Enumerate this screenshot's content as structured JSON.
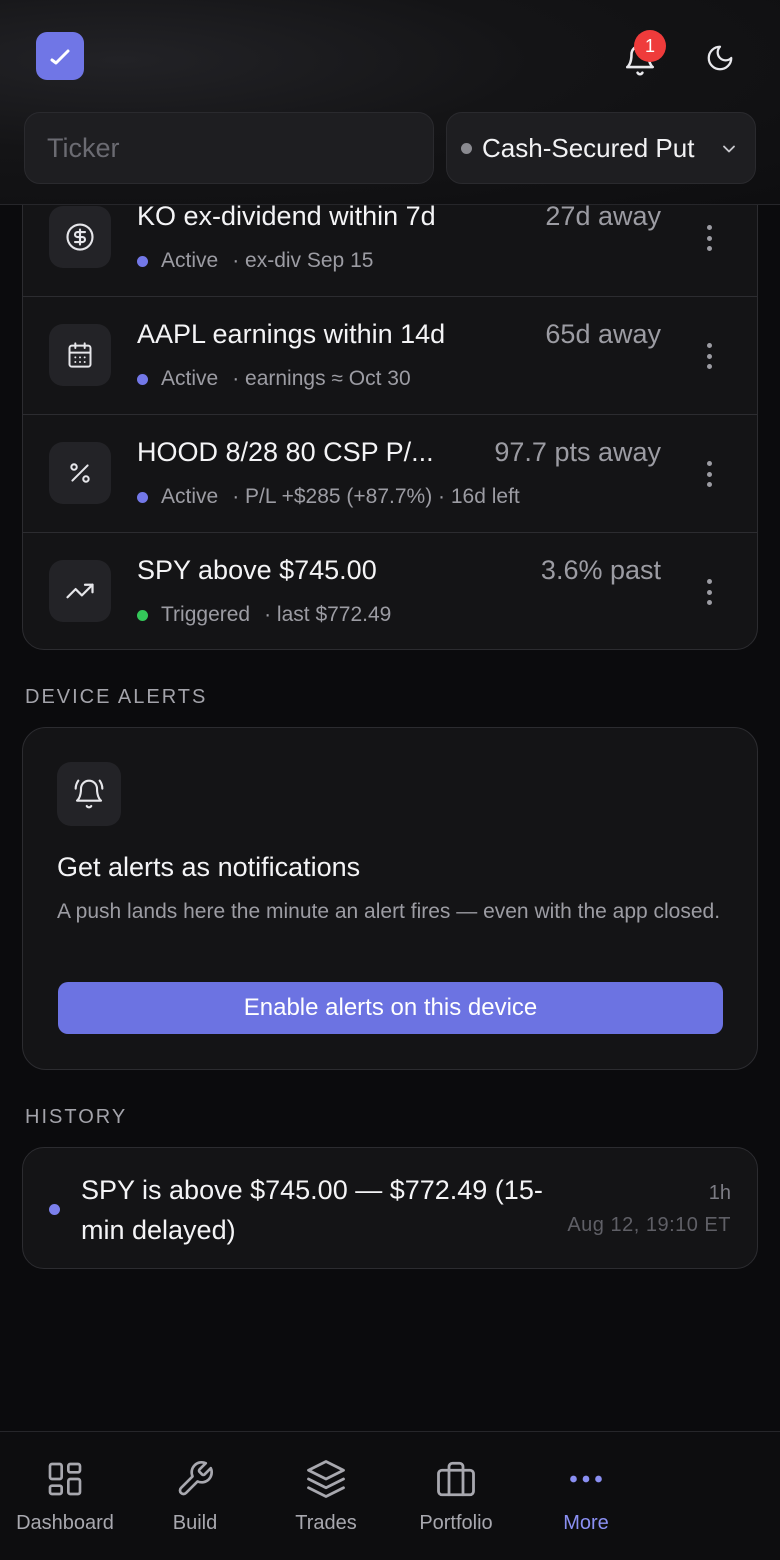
{
  "header": {
    "notifications_count": "1",
    "ticker_placeholder": "Ticker",
    "strategy_value": "Cash-Secured Put"
  },
  "alerts": [
    {
      "icon": "dollar-circle-icon",
      "title": "KO ex-dividend within 7d",
      "meta": "27d away",
      "status": "Active",
      "status_color": "#7378e8",
      "detail": "· ex-div Sep 15"
    },
    {
      "icon": "calendar-icon",
      "title": "AAPL earnings within 14d",
      "meta": "65d away",
      "status": "Active",
      "status_color": "#7378e8",
      "detail": "· earnings ≈ Oct 30"
    },
    {
      "icon": "percent-icon",
      "title": "HOOD 8/28 80 CSP P/...",
      "meta": "97.7 pts away",
      "status": "Active",
      "status_color": "#7378e8",
      "detail": "· P/L +$285 (+87.7%) · 16d left"
    },
    {
      "icon": "trending-up-icon",
      "title": "SPY above $745.00",
      "meta": "3.6% past",
      "status": "Triggered",
      "status_color": "#34c759",
      "detail": "· last $772.49"
    }
  ],
  "device_alerts": {
    "section_label": "DEVICE ALERTS",
    "title": "Get alerts as notifications",
    "description": "A push lands here the minute an alert fires — even with the app closed.",
    "button_label": "Enable alerts on this device"
  },
  "history": {
    "section_label": "HISTORY",
    "items": [
      {
        "text": "SPY is above $745.00 — $772.49 (15-min delayed)",
        "age": "1h",
        "timestamp": "Aug 12, 19:10 ET"
      }
    ]
  },
  "nav": {
    "items": [
      {
        "label": "Dashboard",
        "icon": "dashboard-icon"
      },
      {
        "label": "Build",
        "icon": "wrench-icon"
      },
      {
        "label": "Trades",
        "icon": "layers-icon"
      },
      {
        "label": "Portfolio",
        "icon": "briefcase-icon"
      },
      {
        "label": "More",
        "icon": "more-dots-icon",
        "active": true
      }
    ]
  },
  "colors": {
    "accent": "#6c73e2",
    "badge": "#ef3b3b",
    "active_dot": "#7378e8",
    "triggered_dot": "#34c759"
  }
}
